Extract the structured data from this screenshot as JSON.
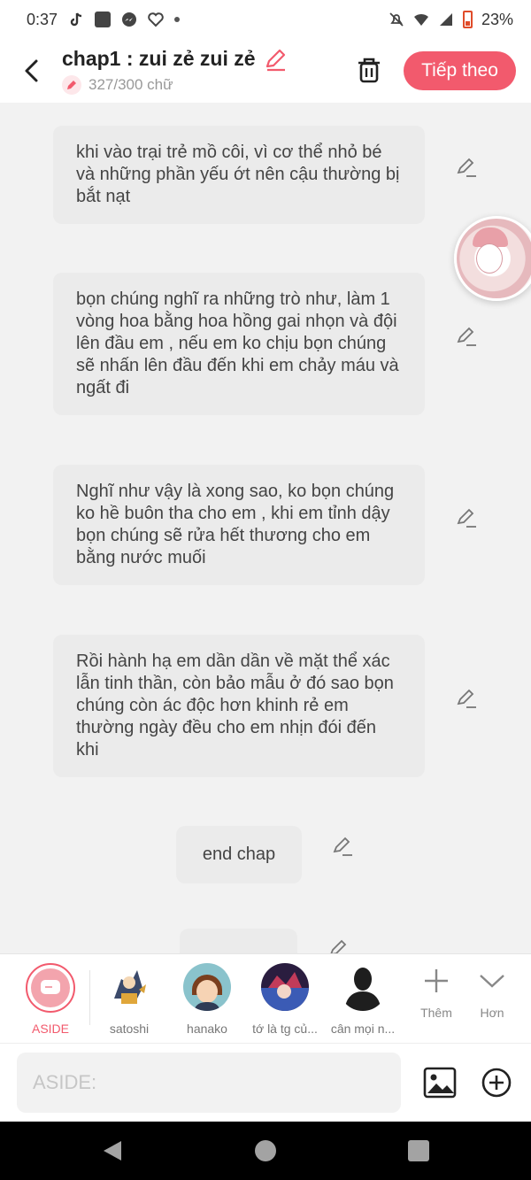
{
  "status_bar": {
    "time": "0:37",
    "battery": "23%"
  },
  "header": {
    "title": "chap1 : zui zẻ zui zẻ",
    "word_count": "327/300 chữ",
    "next_button": "Tiếp theo"
  },
  "messages": [
    {
      "text": "khi vào trại trẻ mồ côi, vì cơ thể nhỏ bé và những phần yếu ớt nên cậu thường bị bắt nạt"
    },
    {
      "text": "bọn chúng nghĩ ra những trò như, làm 1 vòng hoa bằng hoa hồng gai nhọn và đội lên đầu em , nếu em ko chịu bọn chúng sẽ nhấn lên đầu đến khi em chảy máu và ngất đi"
    },
    {
      "text": "Nghĩ như vậy là xong sao, ko bọn chúng ko hề buôn tha cho em , khi em tỉnh dậy bọn chúng sẽ rửa hết thương cho em bằng nước muối"
    },
    {
      "text": "Rồi hành hạ em dần dần về mặt thể xác lẫn tinh thần, còn bảo mẫu ở đó sao bọn chúng còn ác độc hơn khinh rẻ em thường ngày đều cho em nhịn đói đến khi"
    },
    {
      "text": "end chap"
    }
  ],
  "characters": [
    {
      "name": "ASIDE"
    },
    {
      "name": "satoshi"
    },
    {
      "name": "hanako"
    },
    {
      "name": "tớ là tg củ..."
    },
    {
      "name": "cân mọi n..."
    }
  ],
  "tools": {
    "add_label": "Thêm",
    "more_label": "Hơn"
  },
  "input": {
    "placeholder": "ASIDE:"
  },
  "colors": {
    "accent": "#f25a6d",
    "bubble": "#ebebeb",
    "background": "#f2f2f2"
  }
}
